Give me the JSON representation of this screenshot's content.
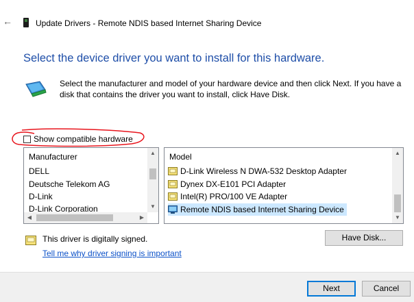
{
  "window": {
    "title": "Update Drivers - Remote NDIS based Internet Sharing Device",
    "back_glyph": "←"
  },
  "heading": "Select the device driver you want to install for this hardware.",
  "instruction": "Select the manufacturer and model of your hardware device and then click Next. If you have a disk that contains the driver you want to install, click Have Disk.",
  "compatible": {
    "label": "Show compatible hardware",
    "checked": false
  },
  "manufacturer_list": {
    "header": "Manufacturer",
    "items": [
      "DELL",
      "Deutsche Telekom AG",
      "D-Link",
      "D-Link Corporation"
    ],
    "selected": "D-Link"
  },
  "model_list": {
    "header": "Model",
    "items": [
      "D-Link Wireless N DWA-532 Desktop Adapter",
      "Dynex DX-E101 PCI Adapter",
      "Intel(R) PRO/100 VE Adapter",
      "Remote NDIS based Internet Sharing Device"
    ],
    "selected": "Remote NDIS based Internet Sharing Device"
  },
  "signing": {
    "status": "This driver is digitally signed.",
    "link": "Tell me why driver signing is important"
  },
  "buttons": {
    "have_disk": "Have Disk...",
    "next": "Next",
    "cancel": "Cancel"
  },
  "colors": {
    "heading": "#1e4ea8",
    "link": "#0a50c8",
    "selection": "#cce8ff",
    "annotation": "#e8141c"
  }
}
